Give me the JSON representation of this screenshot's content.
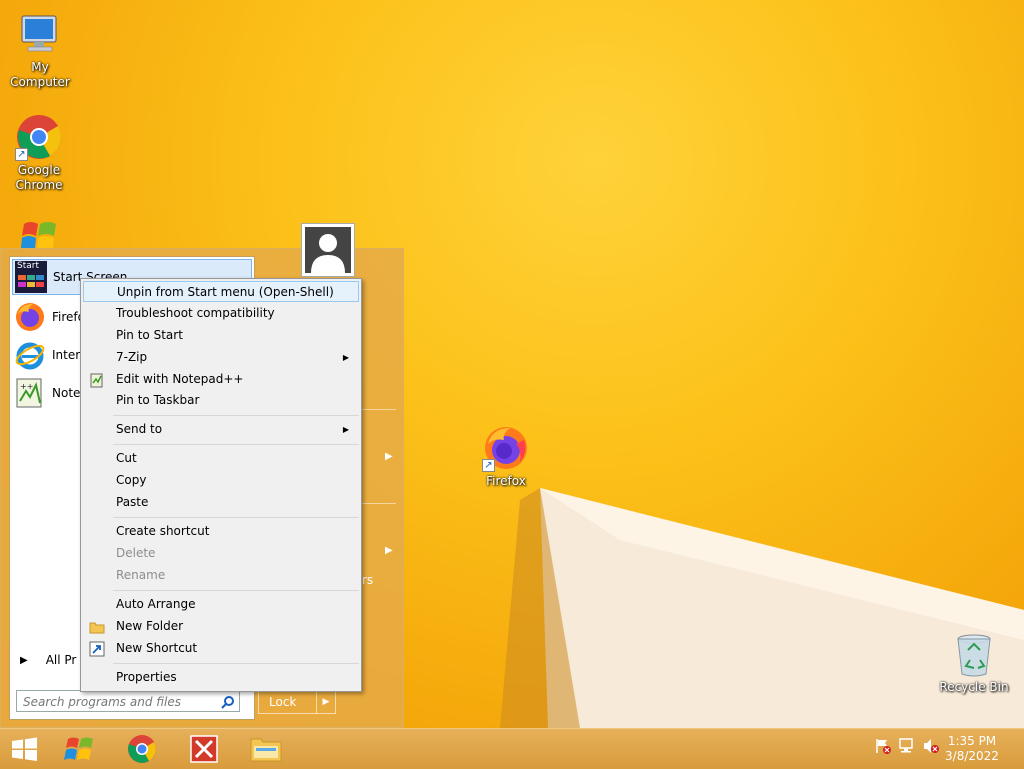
{
  "desktop": {
    "icons": [
      {
        "label": "My Computer"
      },
      {
        "label": "Google Chrome"
      },
      {
        "label": "Firefox"
      },
      {
        "label": "Recycle Bin"
      }
    ]
  },
  "start_menu": {
    "programs": [
      {
        "label": "Start Screen",
        "icon_text": "Start"
      },
      {
        "label": "Firefo"
      },
      {
        "label": "Intern"
      },
      {
        "label": "Notep"
      }
    ],
    "all_programs": "All Pr",
    "search_placeholder": "Search programs and files",
    "right_fragment": "rs",
    "lock_label": "Lock"
  },
  "context_menu": {
    "items": [
      {
        "label": "Unpin from Start menu (Open-Shell)"
      },
      {
        "label": "Troubleshoot compatibility"
      },
      {
        "label": "Pin to Start"
      },
      {
        "label": "7-Zip"
      },
      {
        "label": "Edit with Notepad++"
      },
      {
        "label": "Pin to Taskbar"
      },
      {
        "label": "Send to"
      },
      {
        "label": "Cut"
      },
      {
        "label": "Copy"
      },
      {
        "label": "Paste"
      },
      {
        "label": "Create shortcut"
      },
      {
        "label": "Delete"
      },
      {
        "label": "Rename"
      },
      {
        "label": "Auto Arrange"
      },
      {
        "label": "New Folder"
      },
      {
        "label": "New Shortcut"
      },
      {
        "label": "Properties"
      }
    ]
  },
  "taskbar": {
    "clock_time": "1:35 PM",
    "clock_date": "3/8/2022"
  },
  "colors": {
    "wallpaper": "#f7b500",
    "taskbar": "#d99c3c",
    "menu_hover": "#e5f1fb"
  }
}
